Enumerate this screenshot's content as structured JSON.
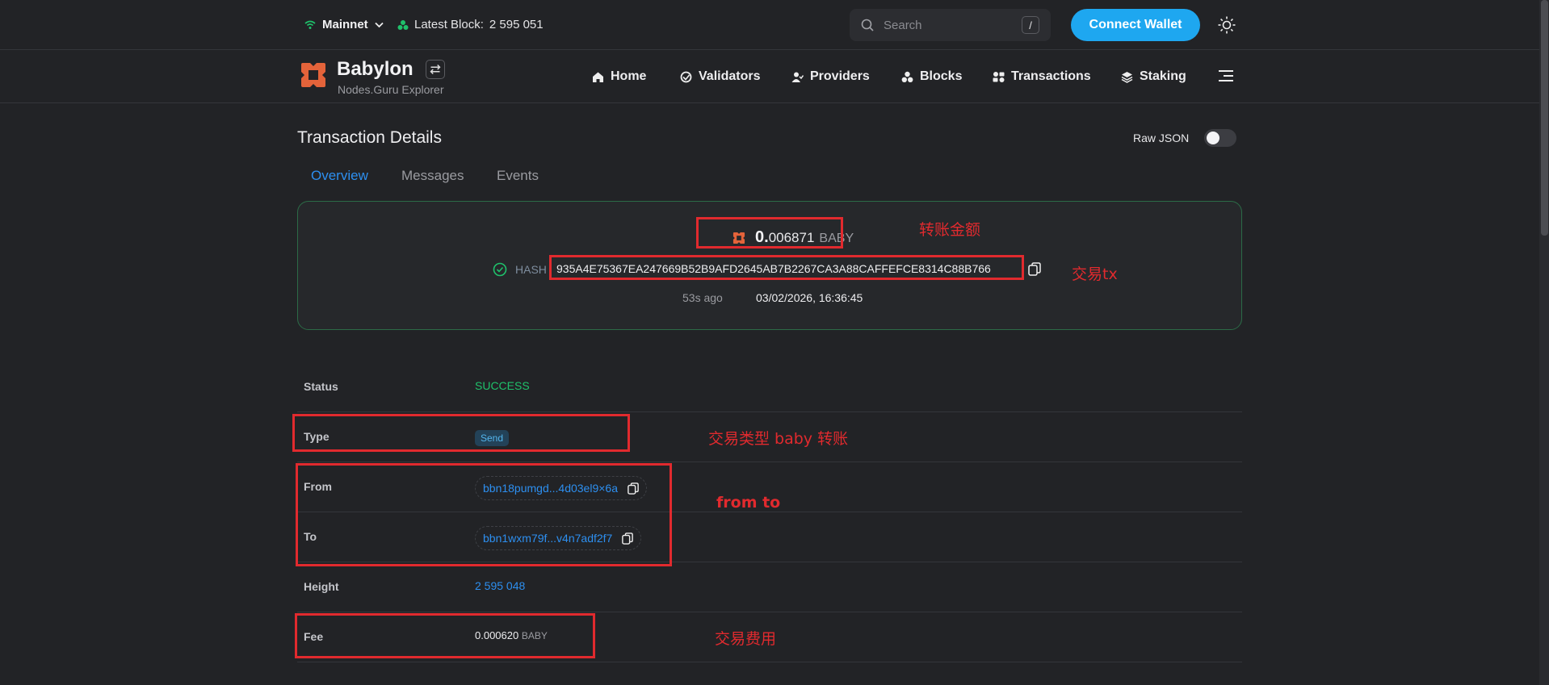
{
  "topbar": {
    "network": "Mainnet",
    "latest_block_label": "Latest Block:",
    "latest_block_value": "2 595 051",
    "search_placeholder": "Search",
    "search_shortcut": "/",
    "connect_label": "Connect Wallet"
  },
  "brand": {
    "name": "Babylon",
    "subtitle": "Nodes.Guru Explorer"
  },
  "nav": [
    "Home",
    "Validators",
    "Providers",
    "Blocks",
    "Transactions",
    "Staking"
  ],
  "page": {
    "title": "Transaction Details",
    "raw_json_label": "Raw JSON",
    "raw_json_on": false,
    "tabs": [
      "Overview",
      "Messages",
      "Events"
    ],
    "active_tab": "Overview"
  },
  "summary": {
    "amount_int": "0.",
    "amount_dec": "006871",
    "amount_unit": "BABY",
    "hash_label": "HASH",
    "hash": "935A4E75367EA247669B52B9AFD2645AB7B2267CA3A88CAFFEFCE8314C88B766",
    "ago": "53s ago",
    "datetime": "03/02/2026, 16:36:45"
  },
  "details": {
    "status_label": "Status",
    "status_value": "SUCCESS",
    "type_label": "Type",
    "type_value": "Send",
    "from_label": "From",
    "from_value": "bbn18pumgd...4d03el9×6a",
    "to_label": "To",
    "to_value": "bbn1wxm79f...v4n7adf2f7",
    "height_label": "Height",
    "height_value": "2 595 048",
    "fee_label": "Fee",
    "fee_value": "0.000620",
    "fee_unit": "BABY"
  },
  "annotations": {
    "amount": "转账金额",
    "tx": "交易tx",
    "type": "交易类型 baby 转账",
    "fromto": "from to",
    "fee": "交易费用"
  },
  "colors": {
    "background": "#222326",
    "accent": "#1ea7f0",
    "link": "#2d8ff0",
    "success": "#1fc16b",
    "annotation": "#e12a2e",
    "brand_orange": "#e4633a"
  },
  "icons": [
    "wifi-icon",
    "chevron-down-icon",
    "block-icon",
    "search-icon",
    "sun-icon",
    "babylon-logo",
    "swap-icon",
    "home-icon",
    "validators-icon",
    "providers-icon",
    "blocks-icon",
    "transactions-icon",
    "staking-icon",
    "menu-icon",
    "check-circle-icon",
    "copy-icon"
  ]
}
